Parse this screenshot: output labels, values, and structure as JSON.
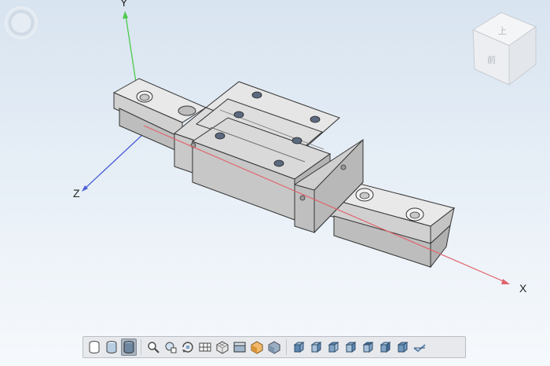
{
  "viewer": {
    "axes": {
      "x_label": "X",
      "y_label": "Y",
      "z_label": "Z"
    },
    "viewcube": {
      "top_face": "上",
      "front_face": "前"
    }
  },
  "toolbar": {
    "buttons": [
      {
        "icon": "cylinder-outline-icon"
      },
      {
        "icon": "cylinder-shaded-icon"
      },
      {
        "icon": "cylinder-dark-icon",
        "active": true
      },
      {
        "icon": "zoom-icon"
      },
      {
        "icon": "zoom-fit-icon"
      },
      {
        "icon": "rotate-icon"
      },
      {
        "icon": "section-view-icon"
      },
      {
        "icon": "mesh-icon"
      },
      {
        "icon": "clip-box-icon"
      },
      {
        "icon": "material-icon"
      },
      {
        "icon": "box-shaded-icon"
      },
      {
        "icon": "view-front-icon"
      },
      {
        "icon": "view-back-icon"
      },
      {
        "icon": "view-left-icon"
      },
      {
        "icon": "view-right-icon"
      },
      {
        "icon": "view-top-icon"
      },
      {
        "icon": "view-bottom-icon"
      },
      {
        "icon": "view-iso-icon"
      },
      {
        "icon": "view-flat-icon"
      }
    ]
  },
  "colors": {
    "x_axis": "#e0646c",
    "y_axis": "#4cc94c",
    "z_axis": "#4a5fd6"
  }
}
